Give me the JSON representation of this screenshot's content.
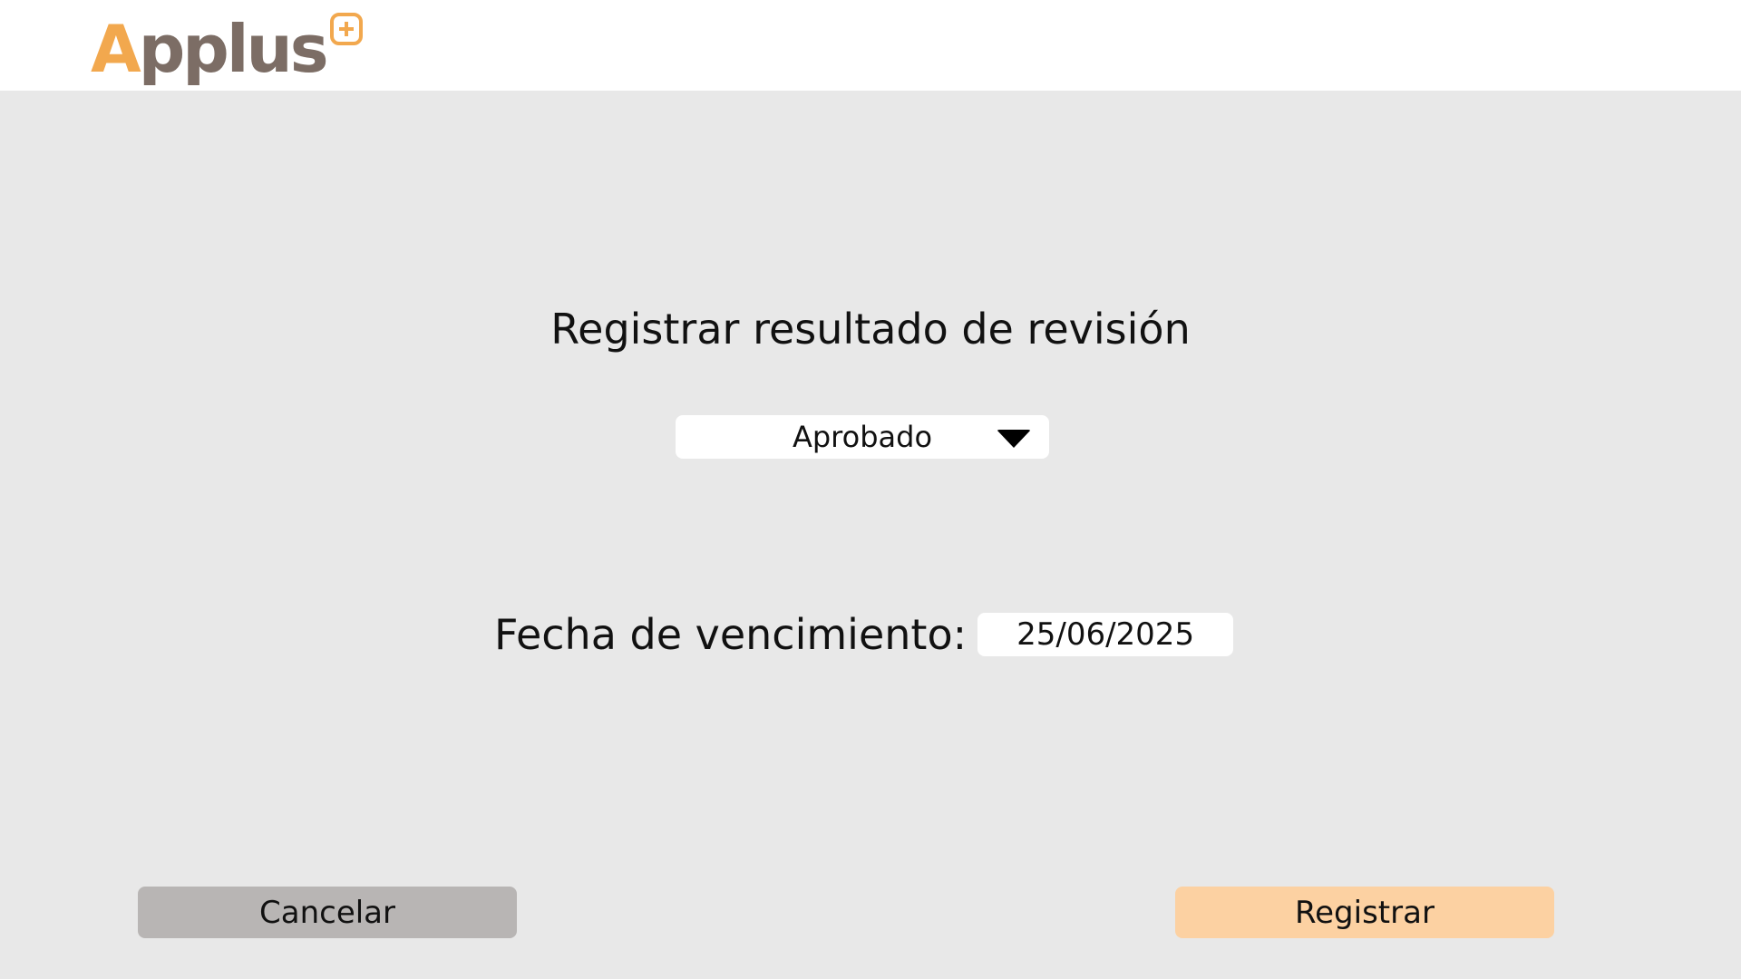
{
  "header": {
    "logo": {
      "text_a": "A",
      "text_rest": "pplus",
      "icon": "plus-icon"
    }
  },
  "form": {
    "title": "Registrar resultado de revisión",
    "result_select": {
      "value": "Aprobado",
      "icon": "caret-down-icon"
    },
    "due_date": {
      "label": "Fecha de vencimiento:",
      "value": "25/06/2025"
    }
  },
  "actions": {
    "cancel_label": "Cancelar",
    "register_label": "Registrar"
  },
  "colors": {
    "brand_orange": "#f2a84e",
    "brand_gray": "#7c6d65",
    "cancel_bg": "#b8b5b4",
    "register_bg": "#fcd1a2",
    "page_bg": "#e8e8e8"
  }
}
